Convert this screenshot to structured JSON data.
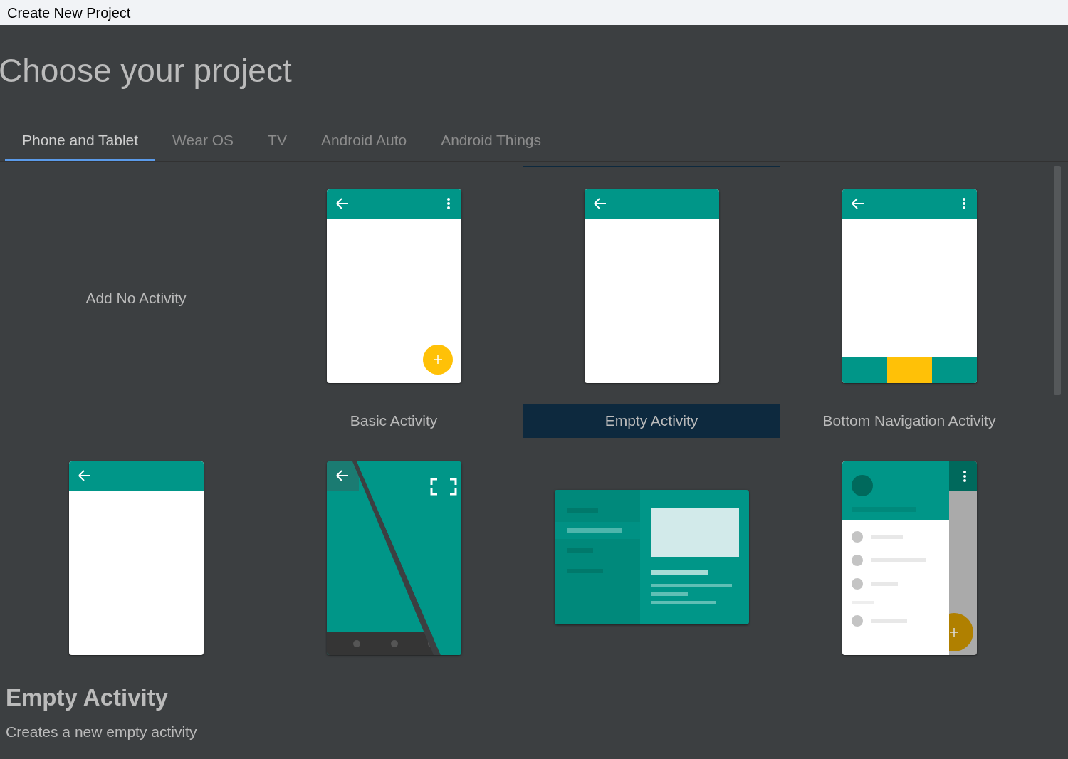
{
  "window": {
    "title": "Create New Project"
  },
  "heading": "Choose your project",
  "tabs": [
    {
      "label": "Phone and Tablet",
      "selected": true
    },
    {
      "label": "Wear OS",
      "selected": false
    },
    {
      "label": "TV",
      "selected": false
    },
    {
      "label": "Android Auto",
      "selected": false
    },
    {
      "label": "Android Things",
      "selected": false
    }
  ],
  "templates": [
    {
      "kind": "none",
      "label": "Add No Activity",
      "selected": false
    },
    {
      "kind": "basic",
      "label": "Basic Activity",
      "selected": false
    },
    {
      "kind": "empty",
      "label": "Empty Activity",
      "selected": true
    },
    {
      "kind": "bottom_nav",
      "label": "Bottom Navigation Activity",
      "selected": false
    },
    {
      "kind": "empty",
      "selected": false
    },
    {
      "kind": "fullscreen",
      "selected": false
    },
    {
      "kind": "master_detail",
      "selected": false
    },
    {
      "kind": "nav_drawer",
      "selected": false
    }
  ],
  "details": {
    "title": "Empty Activity",
    "description": "Creates a new empty activity"
  }
}
